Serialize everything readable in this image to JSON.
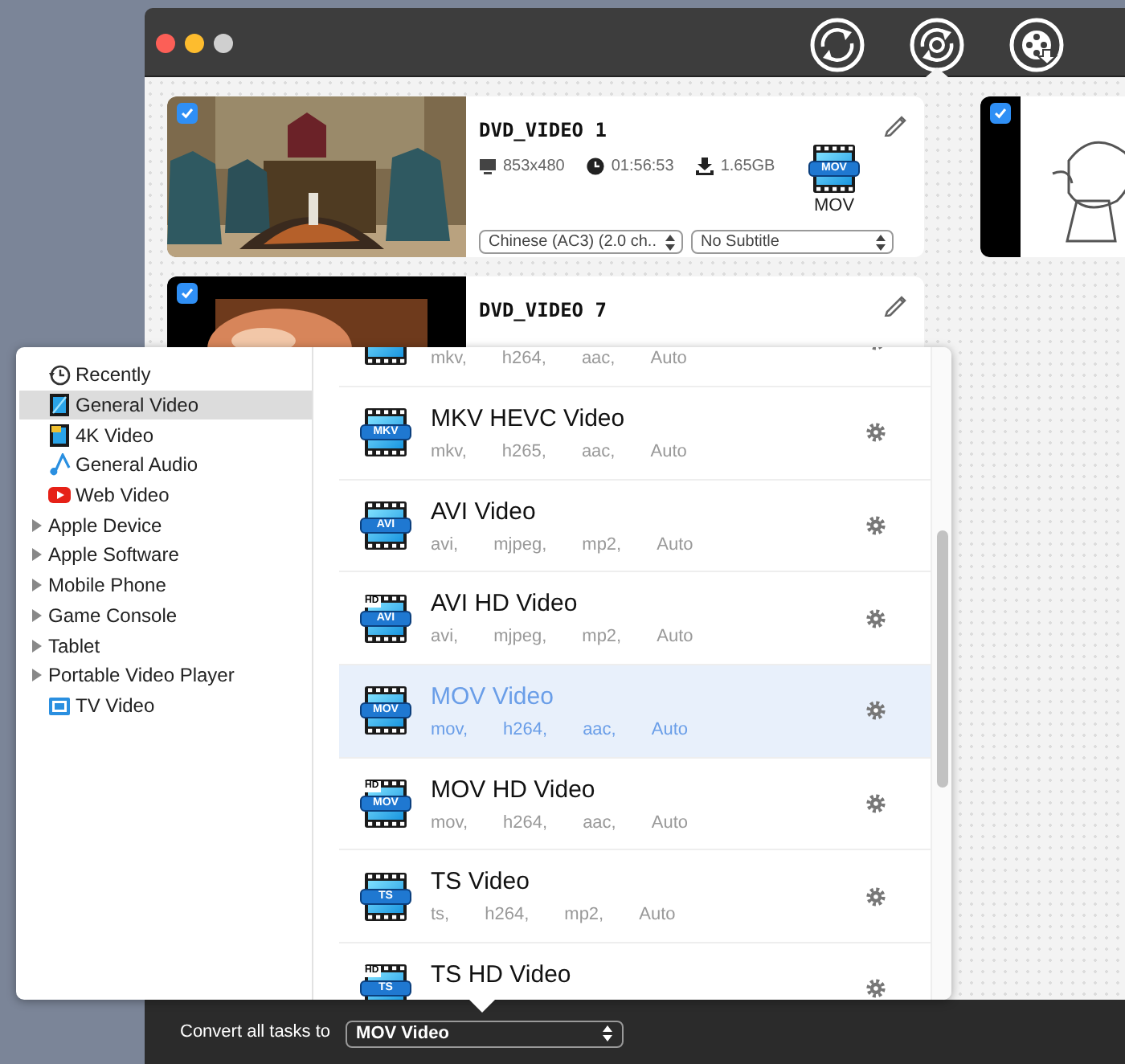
{
  "toolbar": {
    "tabs": [
      {
        "kind": "convert",
        "selected": false
      },
      {
        "kind": "disc",
        "selected": true
      },
      {
        "kind": "film",
        "selected": false
      }
    ]
  },
  "cards": [
    {
      "kind": "full",
      "checked": true,
      "title": "DVD_VIDEO 1",
      "resolution": "853x480",
      "duration": "01:56:53",
      "size": "1.65GB",
      "format_badge": "MOV",
      "format_label": "MOV",
      "audio": "Chinese (AC3) (2.0 ch..",
      "subtitle": "No Subtitle"
    },
    {
      "kind": "full",
      "checked": true,
      "title": "DVD_VIDEO 7"
    },
    {
      "kind": "thumb",
      "checked": true
    }
  ],
  "popover": {
    "categories": [
      {
        "kind": "recent",
        "label": "Recently",
        "selected": false
      },
      {
        "kind": "video",
        "label": "General Video",
        "selected": true
      },
      {
        "kind": "video4k",
        "label": "4K Video",
        "selected": false
      },
      {
        "kind": "audio",
        "label": "General Audio",
        "selected": false
      },
      {
        "kind": "web",
        "label": "Web Video",
        "selected": false
      },
      {
        "kind": "group",
        "label": "Apple Device",
        "expanded": false,
        "selected": false
      },
      {
        "kind": "group",
        "label": "Apple Software",
        "expanded": false,
        "selected": false
      },
      {
        "kind": "group",
        "label": "Mobile Phone",
        "expanded": false,
        "selected": false
      },
      {
        "kind": "group",
        "label": "Game Console",
        "expanded": false,
        "selected": false
      },
      {
        "kind": "group",
        "label": "Tablet",
        "expanded": false,
        "selected": false
      },
      {
        "kind": "group",
        "label": "Portable Video Player",
        "expanded": false,
        "selected": false
      },
      {
        "kind": "tv",
        "label": "TV Video",
        "selected": false
      }
    ],
    "formats": [
      {
        "specs": [
          "mkv,",
          "h264,",
          "aac,",
          "Auto"
        ],
        "selected": false
      },
      {
        "badge": "MKV",
        "name": "MKV HEVC Video",
        "specs": [
          "mkv,",
          "h265,",
          "aac,",
          "Auto"
        ],
        "selected": false
      },
      {
        "badge": "AVI",
        "name": "AVI Video",
        "specs": [
          "avi,",
          "mjpeg,",
          "mp2,",
          "Auto"
        ],
        "selected": false
      },
      {
        "badge": "AVI",
        "hd": "HD",
        "name": "AVI HD Video",
        "specs": [
          "avi,",
          "mjpeg,",
          "mp2,",
          "Auto"
        ],
        "selected": false
      },
      {
        "badge": "MOV",
        "name": "MOV Video",
        "specs": [
          "mov,",
          "h264,",
          "aac,",
          "Auto"
        ],
        "selected": true
      },
      {
        "badge": "MOV",
        "hd": "HD",
        "name": "MOV HD Video",
        "specs": [
          "mov,",
          "h264,",
          "aac,",
          "Auto"
        ],
        "selected": false
      },
      {
        "badge": "TS",
        "name": "TS Video",
        "specs": [
          "ts,",
          "h264,",
          "mp2,",
          "Auto"
        ],
        "selected": false
      },
      {
        "badge": "TS",
        "hd": "HD",
        "name": "TS HD Video",
        "selected": false
      }
    ]
  },
  "bottom_bar": {
    "label": "Convert all tasks to",
    "format": "MOV Video"
  }
}
